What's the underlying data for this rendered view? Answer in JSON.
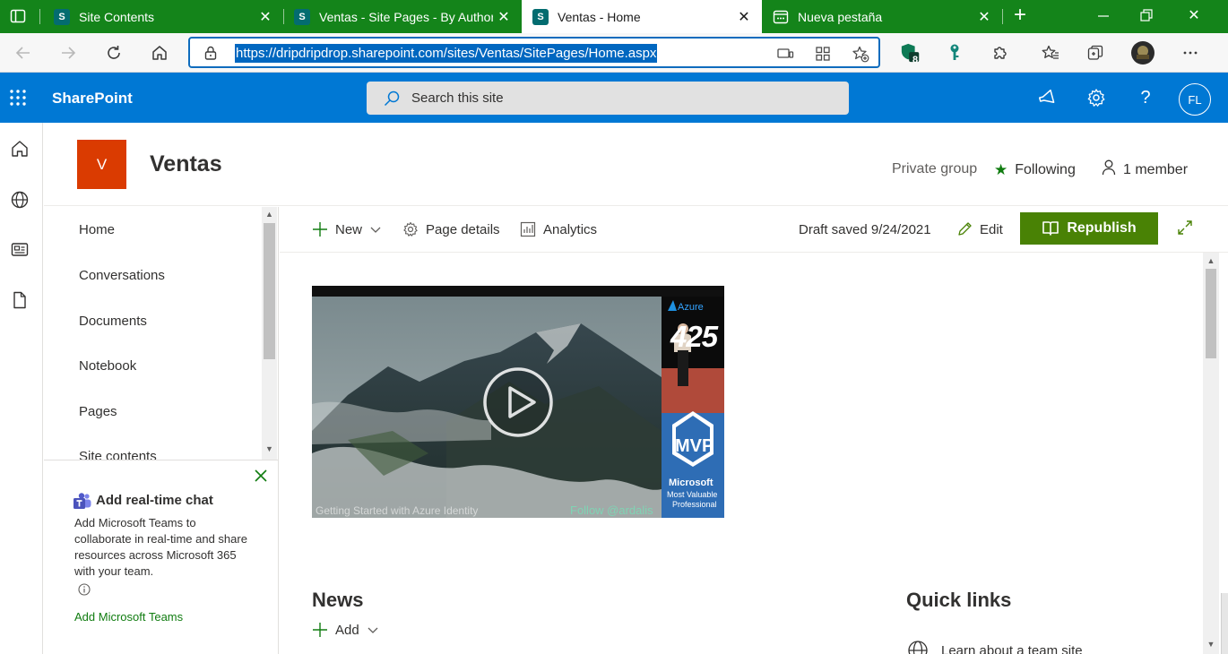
{
  "browser": {
    "tabs": [
      {
        "title": "Site Contents",
        "favicon": "S",
        "active": false
      },
      {
        "title": "Ventas - Site Pages - By Author",
        "favicon": "S",
        "active": false
      },
      {
        "title": "Ventas - Home",
        "favicon": "S",
        "active": true
      },
      {
        "title": "Nueva pestaña",
        "favicon": "newtab",
        "active": false
      }
    ],
    "url": "https://dripdripdrop.sharepoint.com/sites/Ventas/SitePages/Home.aspx",
    "extension_badge": "8",
    "accent_color": "#14841a"
  },
  "suite": {
    "brand": "SharePoint",
    "search_placeholder": "Search this site",
    "user_initials": "FL",
    "color": "#0078d4"
  },
  "site": {
    "logo_letter": "V",
    "title": "Ventas",
    "privacy": "Private group",
    "following": "Following",
    "members": "1 member",
    "logo_color": "#da3b01"
  },
  "nav": {
    "items": [
      "Home",
      "Conversations",
      "Documents",
      "Notebook",
      "Pages",
      "Site contents"
    ]
  },
  "teams_promo": {
    "title": "Add real-time chat",
    "description": "Add Microsoft Teams to collaborate in real-time and share resources across Microsoft 365 with your team.",
    "link": "Add Microsoft Teams"
  },
  "commandbar": {
    "new": "New",
    "page_details": "Page details",
    "analytics": "Analytics",
    "draft_status": "Draft saved 9/24/2021",
    "edit": "Edit",
    "republish": "Republish",
    "republish_color": "#498205"
  },
  "video": {
    "caption": "Getting Started with Azure Identity",
    "follow": "Follow @ardalis",
    "azure_label": "Azure",
    "show_label": "425",
    "mvp_label": "MVP",
    "microsoft_label": "Microsoft",
    "mvp_line1": "Most Valuable",
    "mvp_line2": "Professional"
  },
  "news": {
    "title": "News",
    "add": "Add"
  },
  "quicklinks": {
    "title": "Quick links",
    "first": "Learn about a team site"
  }
}
